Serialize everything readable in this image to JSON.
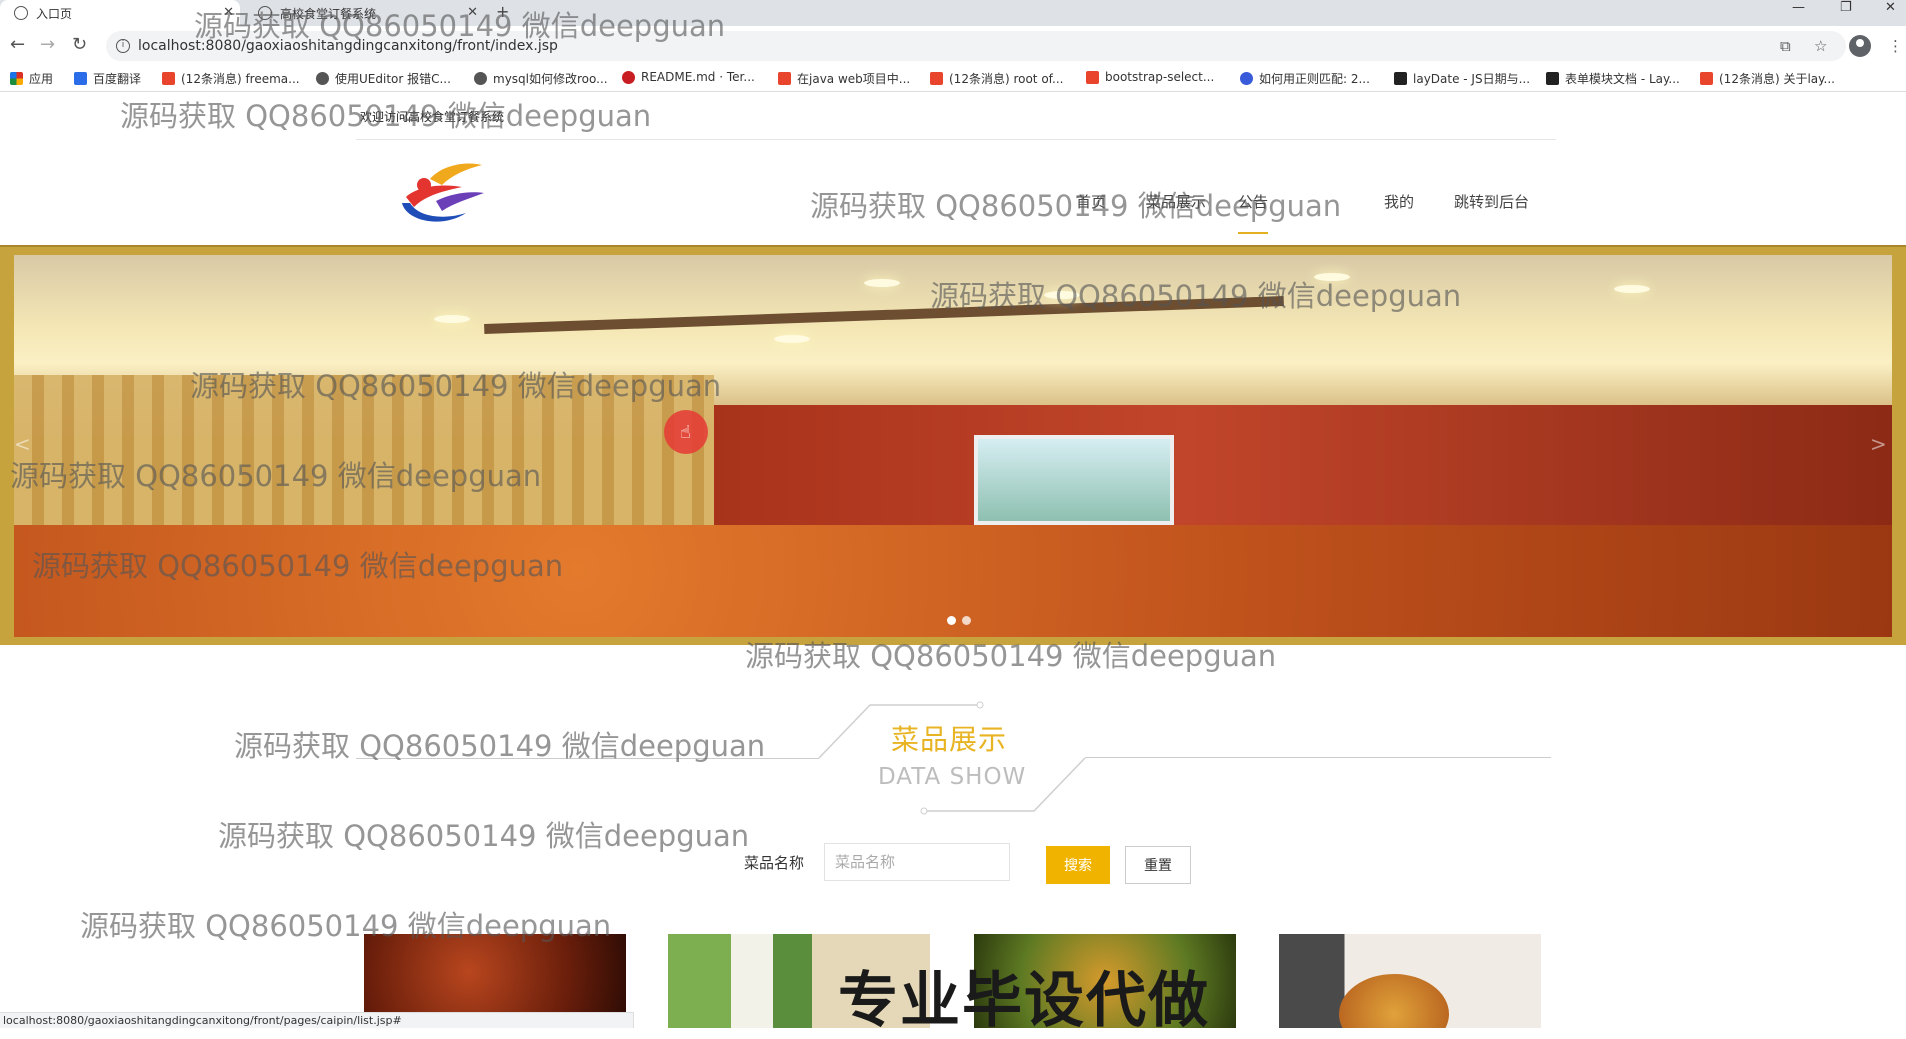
{
  "browser": {
    "tabs": [
      {
        "title": "入口页",
        "active": true
      },
      {
        "title": "高校食堂订餐系统",
        "active": false
      }
    ],
    "new_tab": "+",
    "url": "localhost:8080/gaoxiaoshitangdingcanxitong/front/index.jsp",
    "bookmarks": [
      {
        "label": "应用",
        "color": "#d93025"
      },
      {
        "label": "百度翻译",
        "color": "#2b6de8"
      },
      {
        "label": "(12条消息) freema...",
        "color": "#e8452c"
      },
      {
        "label": "使用UEditor 报错C...",
        "color": "#555555"
      },
      {
        "label": "mysql如何修改roo...",
        "color": "#555555"
      },
      {
        "label": "README.md · Ter...",
        "color": "#c71d23"
      },
      {
        "label": "在java web项目中...",
        "color": "#e8452c"
      },
      {
        "label": "(12条消息) root of...",
        "color": "#e8452c"
      },
      {
        "label": "bootstrap-select...",
        "color": "#e8452c"
      },
      {
        "label": "如何用正则匹配: 2...",
        "color": "#3a5bd9"
      },
      {
        "label": "layDate - JS日期与...",
        "color": "#222222"
      },
      {
        "label": "表单模块文档 - Lay...",
        "color": "#222222"
      },
      {
        "label": "(12条消息) 关于lay...",
        "color": "#e8452c"
      }
    ],
    "status_url": "localhost:8080/gaoxiaoshitangdingcanxitong/front/pages/caipin/list.jsp#"
  },
  "site": {
    "welcome": "欢迎访问高校食堂订餐系统",
    "nav": [
      {
        "label": "首页",
        "active": false
      },
      {
        "label": "菜品展示",
        "active": false
      },
      {
        "label": "公告",
        "active": true
      },
      {
        "label": "我的",
        "active": false
      },
      {
        "label": "跳转到后台",
        "active": false
      }
    ],
    "carousel": {
      "prev": "<",
      "next": ">",
      "slides": 2,
      "current": 1
    }
  },
  "section": {
    "title": "菜品展示",
    "subtitle": "DATA SHOW"
  },
  "search": {
    "label": "菜品名称",
    "placeholder": "菜品名称",
    "value": "",
    "search_button": "搜索",
    "reset_button": "重置"
  },
  "promo_overlay": "专业毕设代做",
  "watermark": "源码获取 QQ86050149 微信deepguan",
  "colors": {
    "accent": "#e8b423",
    "button": "#f0b400",
    "cursor_highlight": "#e53935"
  }
}
